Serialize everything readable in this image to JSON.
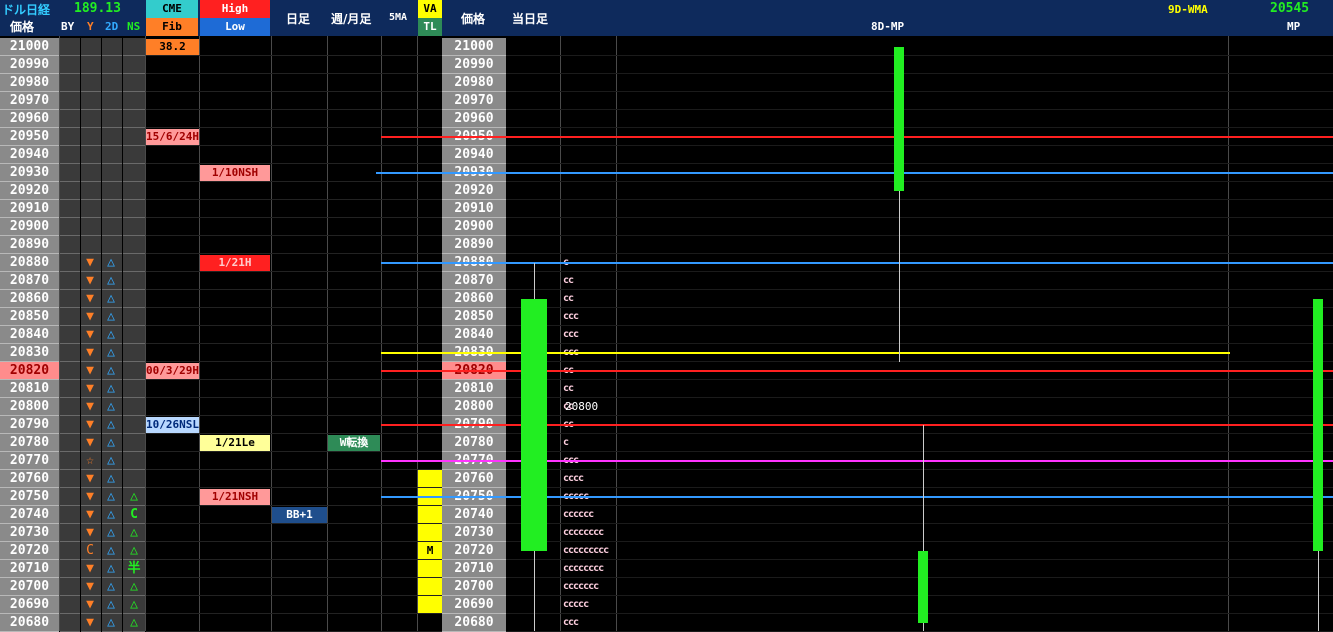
{
  "header": {
    "title": "ドル日経",
    "by_value": "189.13",
    "col_price": "価格",
    "col_by": "BY",
    "col_y": "Y",
    "col_2d": "2D",
    "col_ns": "NS",
    "col_cme": "CME",
    "col_fib": "Fib",
    "col_high": "High",
    "col_low": "Low",
    "col_daily": "日足",
    "col_weekmonth": "週/月足",
    "col_5ma": "5MA",
    "col_va": "VA",
    "col_tl": "TL",
    "col_price2": "価格",
    "col_today": "当日足",
    "wma_label": "9D-WMA",
    "wma_value": "20545",
    "mp_label": "MP",
    "mp8d_label": "8D-MP"
  },
  "prices": [
    "21000",
    "20990",
    "20980",
    "20970",
    "20960",
    "20950",
    "20940",
    "20930",
    "20920",
    "20910",
    "20900",
    "20890",
    "20880",
    "20870",
    "20860",
    "20850",
    "20840",
    "20830",
    "20820",
    "20810",
    "20800",
    "20790",
    "20780",
    "20770",
    "20760",
    "20750",
    "20740",
    "20730",
    "20720",
    "20710",
    "20700",
    "20690",
    "20680"
  ],
  "price_highlights": {
    "20820": "#ff8c8c"
  },
  "y_marks": {
    "20880": "▼",
    "20870": "▼",
    "20860": "▼",
    "20850": "▼",
    "20840": "▼",
    "20830": "▼",
    "20820": "▼",
    "20810": "▼",
    "20800": "▼",
    "20790": "▼",
    "20780": "▼",
    "20770": "☆",
    "20760": "▼",
    "20750": "▼",
    "20740": "▼",
    "20730": "▼",
    "20720": "C",
    "20710": "▼",
    "20700": "▼",
    "20690": "▼",
    "20680": "▼"
  },
  "d2_marks": {
    "20880": "△",
    "20870": "△",
    "20860": "△",
    "20850": "△",
    "20840": "△",
    "20830": "△",
    "20820": "△",
    "20810": "△",
    "20800": "△",
    "20790": "△",
    "20780": "△",
    "20770": "△",
    "20760": "△",
    "20750": "△",
    "20740": "△",
    "20730": "△",
    "20720": "△",
    "20710": "△",
    "20700": "△",
    "20690": "△",
    "20680": "△"
  },
  "ns_marks": {
    "20750": "△",
    "20740": "C",
    "20730": "△",
    "20720": "△",
    "20710": "半",
    "20700": "△",
    "20690": "△",
    "20680": "△"
  },
  "cme_labels": [
    {
      "price": "21000",
      "text": "38.2",
      "bg": "#ff7f27",
      "fg": "#000"
    },
    {
      "price": "20950",
      "text": "15/6/24H",
      "bg": "#ff9999",
      "fg": "#a00000"
    },
    {
      "price": "20820",
      "text": "00/3/29H",
      "bg": "#ff9999",
      "fg": "#a00000"
    },
    {
      "price": "20790",
      "text": "10/26NSL",
      "bg": "#b8d8ff",
      "fg": "#002a7a"
    }
  ],
  "hl_labels": [
    {
      "price": "20930",
      "text": "1/10NSH",
      "bg": "#ff9999",
      "fg": "#a00000"
    },
    {
      "price": "20880",
      "text": "1/21H",
      "bg": "#ff2020",
      "fg": "#ffcccc"
    },
    {
      "price": "20780",
      "text": "1/21Le",
      "bg": "#ffff99",
      "fg": "#000"
    },
    {
      "price": "20750",
      "text": "1/21NSH",
      "bg": "#ff9999",
      "fg": "#a00000"
    }
  ],
  "daily_labels": [
    {
      "price": "20740",
      "text": "BB+1",
      "bg": "#1f4e8c",
      "fg": "#fff"
    }
  ],
  "wm_labels": [
    {
      "price": "20780",
      "text": "W転換",
      "bg": "#2e8b57",
      "fg": "#fff"
    }
  ],
  "va_prices": [
    "20760",
    "20750",
    "20740",
    "20730",
    "20720",
    "20710",
    "20700",
    "20690"
  ],
  "va_marker": {
    "price": "20720",
    "text": "M"
  },
  "tpo": {
    "20880": "c",
    "20870": "cc",
    "20860": "cc",
    "20850": "ccc",
    "20840": "ccc",
    "20830": "ccc",
    "20820": "cc",
    "20810": "cc",
    "20800": "cc",
    "20790": "cc",
    "20780": "c",
    "20770": "ccc",
    "20760": "cccc",
    "20750": "ccccc",
    "20740": "cccccc",
    "20730": "cccccccc",
    "20720": "ccccccccc",
    "20710": "cccccccc",
    "20700": "ccccccc",
    "20690": "ccccc",
    "20680": "ccc"
  },
  "current_price": {
    "price": "20800",
    "text": "20800"
  },
  "hlines": [
    {
      "price": "20950",
      "color": "#ff2020",
      "from": "5ma"
    },
    {
      "price": "20930",
      "color": "#3399ff",
      "from": "wm"
    },
    {
      "price": "20880",
      "color": "#3399ff",
      "from": "5ma"
    },
    {
      "price": "20830",
      "color": "#ffff00",
      "from": "5ma",
      "to": "wma"
    },
    {
      "price": "20820",
      "color": "#ff2020",
      "from": "5ma"
    },
    {
      "price": "20790",
      "color": "#ff2020",
      "from": "5ma"
    },
    {
      "price": "20770",
      "color": "#ff33ff",
      "from": "5ma"
    },
    {
      "price": "20750",
      "color": "#3399ff",
      "from": "5ma"
    }
  ],
  "candles": [
    {
      "name": "today",
      "open": 20720,
      "close": 20860,
      "high": 20880,
      "low": 20680,
      "color": "#22ee22"
    },
    {
      "name": "8d-mp",
      "open": 20920,
      "close": 21000,
      "high": 21000,
      "low": 20830,
      "color": "#22ee22"
    },
    {
      "name": "prev",
      "open": 20680,
      "close": 20720,
      "high": 20790,
      "low": 20680,
      "color": "#22ee22"
    },
    {
      "name": "mp",
      "open": 20720,
      "close": 20860,
      "high": 20860,
      "low": 20680,
      "color": "#22ee22"
    }
  ],
  "colors": {
    "header_bg": "#0e2a5c",
    "price_bg": "#8a8a8a",
    "y_mark": "#ff7f27",
    "d2_mark": "#33aaff",
    "ns_mark": "#22ee22",
    "by_value": "#22ee22",
    "wma": "#ffff00"
  }
}
